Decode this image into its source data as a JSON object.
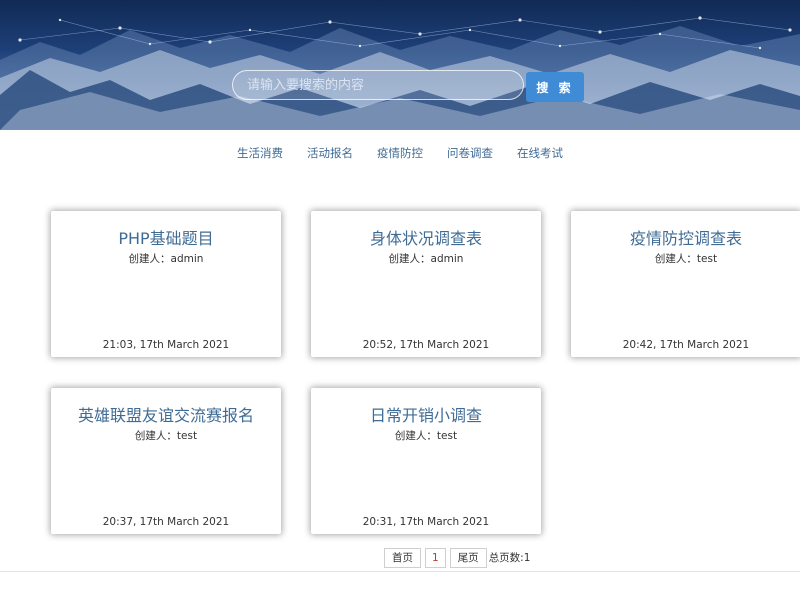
{
  "search": {
    "placeholder": "请输入要搜索的内容",
    "button_label": "搜 索"
  },
  "nav": {
    "items": [
      "生活消费",
      "活动报名",
      "疫情防控",
      "问卷调查",
      "在线考试"
    ]
  },
  "cards": [
    {
      "title": "PHP基础题目",
      "creator": "创建人：admin",
      "date": "21:03, 17th March 2021"
    },
    {
      "title": "身体状况调查表",
      "creator": "创建人：admin",
      "date": "20:52, 17th March 2021"
    },
    {
      "title": "疫情防控调查表",
      "creator": "创建人：test",
      "date": "20:42, 17th March 2021"
    },
    {
      "title": "英雄联盟友谊交流赛报名",
      "creator": "创建人：test",
      "date": "20:37, 17th March 2021"
    },
    {
      "title": "日常开销小调查",
      "creator": "创建人：test",
      "date": "20:31, 17th March 2021"
    }
  ],
  "pagination": {
    "first_label": "首页",
    "current_page": "1",
    "last_label": "尾页",
    "total_text": "总页数:1"
  },
  "colors": {
    "link": "#3f6c95",
    "search_button": "#3f8bd6",
    "current_page": "#c0392b"
  }
}
